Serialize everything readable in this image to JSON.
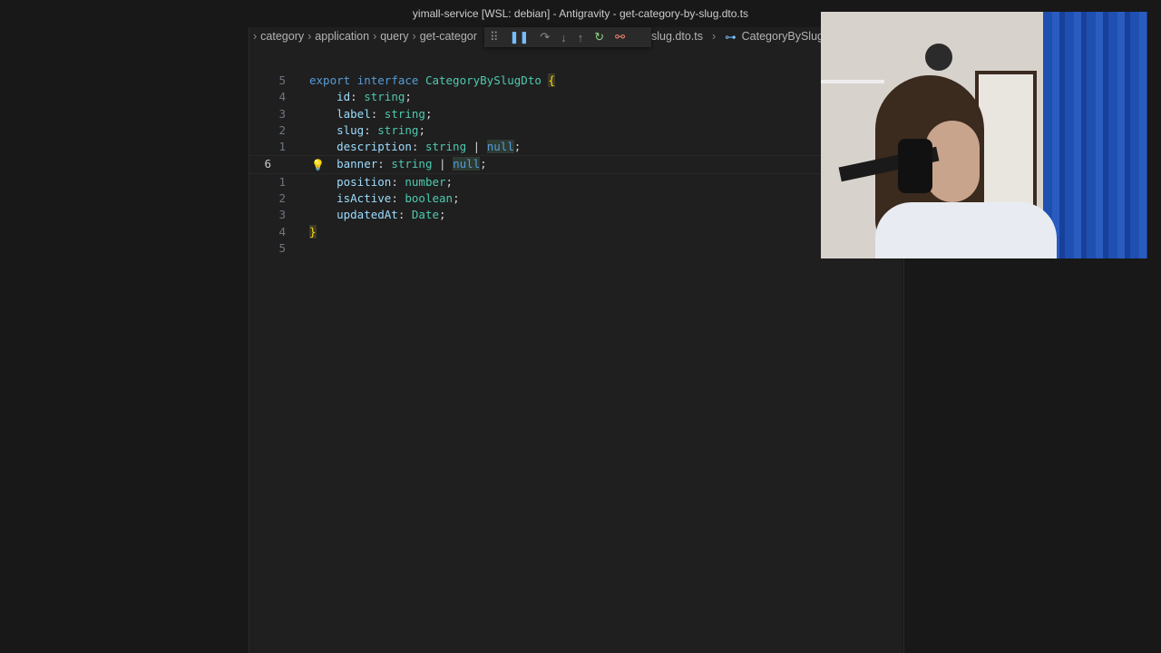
{
  "window": {
    "title": "yimall-service [WSL: debian] - Antigravity - get-category-by-slug.dto.ts"
  },
  "breadcrumb": {
    "items": [
      "category",
      "application",
      "query",
      "get-categor"
    ],
    "file": "slug.dto.ts",
    "symbol": "CategoryBySlugD"
  },
  "debug_toolbar": {
    "icons": [
      "grip-icon",
      "pause-icon",
      "step-over-icon",
      "step-into-icon",
      "step-out-icon",
      "restart-icon",
      "disconnect-icon"
    ]
  },
  "editor": {
    "lines": [
      {
        "num": "5",
        "tokens": [
          {
            "t": "export ",
            "c": "kw"
          },
          {
            "t": "interface ",
            "c": "kw"
          },
          {
            "t": "CategoryBySlugDto ",
            "c": "iface"
          },
          {
            "t": "{",
            "c": "brace"
          }
        ]
      },
      {
        "num": "4",
        "tokens": [
          {
            "t": "    id",
            "c": "prop"
          },
          {
            "t": ": ",
            "c": "pun"
          },
          {
            "t": "string",
            "c": "type"
          },
          {
            "t": ";",
            "c": "pun"
          }
        ]
      },
      {
        "num": "3",
        "tokens": [
          {
            "t": "    label",
            "c": "prop"
          },
          {
            "t": ": ",
            "c": "pun"
          },
          {
            "t": "string",
            "c": "type"
          },
          {
            "t": ";",
            "c": "pun"
          }
        ]
      },
      {
        "num": "2",
        "tokens": [
          {
            "t": "    slug",
            "c": "prop"
          },
          {
            "t": ": ",
            "c": "pun"
          },
          {
            "t": "string",
            "c": "type"
          },
          {
            "t": ";",
            "c": "pun"
          }
        ]
      },
      {
        "num": "1",
        "tokens": [
          {
            "t": "    description",
            "c": "prop"
          },
          {
            "t": ": ",
            "c": "pun"
          },
          {
            "t": "string",
            "c": "type"
          },
          {
            "t": " | ",
            "c": "pun"
          },
          {
            "t": "null",
            "c": "nullv"
          },
          {
            "t": ";",
            "c": "pun"
          }
        ]
      },
      {
        "num": "6",
        "current": true,
        "tokens": [
          {
            "t": "    banner",
            "c": "prop"
          },
          {
            "t": ": ",
            "c": "pun"
          },
          {
            "t": "string",
            "c": "type"
          },
          {
            "t": " | ",
            "c": "pun"
          },
          {
            "t": "null",
            "c": "nullv"
          },
          {
            "t": ";",
            "c": "pun"
          }
        ]
      },
      {
        "num": "1",
        "tokens": [
          {
            "t": "    position",
            "c": "prop"
          },
          {
            "t": ": ",
            "c": "pun"
          },
          {
            "t": "number",
            "c": "type"
          },
          {
            "t": ";",
            "c": "pun"
          }
        ]
      },
      {
        "num": "2",
        "tokens": [
          {
            "t": "    isActive",
            "c": "prop"
          },
          {
            "t": ": ",
            "c": "pun"
          },
          {
            "t": "boolean",
            "c": "type"
          },
          {
            "t": ";",
            "c": "pun"
          }
        ]
      },
      {
        "num": "3",
        "tokens": [
          {
            "t": "    updatedAt",
            "c": "prop"
          },
          {
            "t": ": ",
            "c": "pun"
          },
          {
            "t": "Date",
            "c": "type"
          },
          {
            "t": ";",
            "c": "pun"
          }
        ]
      },
      {
        "num": "4",
        "tokens": [
          {
            "t": "}",
            "c": "brace"
          }
        ]
      },
      {
        "num": "5",
        "tokens": []
      }
    ]
  },
  "colors": {
    "accent": "#75beff",
    "keyword": "#569cd6",
    "type": "#4ec9b0",
    "property": "#9cdcfe",
    "brace": "#ffd700"
  }
}
